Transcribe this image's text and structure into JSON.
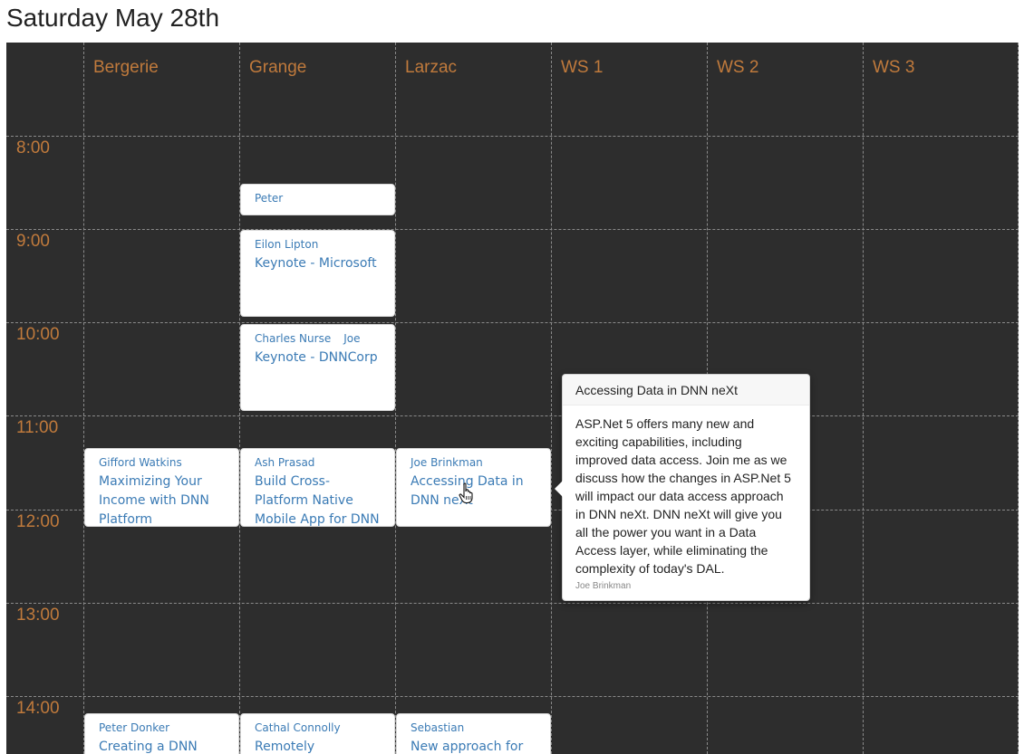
{
  "page": {
    "title": "Saturday May 28th"
  },
  "rooms": [
    "Bergerie",
    "Grange",
    "Larzac",
    "WS 1",
    "WS 2",
    "WS 3"
  ],
  "times": [
    "8:00",
    "9:00",
    "10:00",
    "11:00",
    "12:00",
    "13:00",
    "14:00"
  ],
  "sessions": {
    "s_peter": {
      "speakers": [
        "Peter"
      ],
      "title": ""
    },
    "s_keynote_ms": {
      "speakers": [
        "Eilon Lipton"
      ],
      "title": "Keynote - Microsoft"
    },
    "s_keynote_dnn": {
      "speakers": [
        "Charles Nurse",
        "Joe"
      ],
      "title": "Keynote - DNNCorp"
    },
    "s_income": {
      "speakers": [
        "Gifford Watkins"
      ],
      "title": "Maximizing Your Income with DNN Platform"
    },
    "s_mobile": {
      "speakers": [
        "Ash Prasad"
      ],
      "title": "Build Cross-Platform Native Mobile App for DNN"
    },
    "s_data": {
      "speakers": [
        "Joe Brinkman"
      ],
      "title": "Accessing Data in DNN neXt"
    },
    "s_creating": {
      "speakers": [
        "Peter Donker"
      ],
      "title": "Creating a DNN"
    },
    "s_remotely": {
      "speakers": [
        "Cathal Connolly"
      ],
      "title": "Remotely"
    },
    "s_newapproach": {
      "speakers": [
        "Sebastian"
      ],
      "title": "New approach for"
    }
  },
  "popover": {
    "title": "Accessing Data in DNN neXt",
    "body": "ASP.Net 5 offers many new and exciting capabilities, including improved data access. Join me as we discuss how the changes in ASP.Net 5 will impact our data access approach in DNN neXt. DNN neXt will give you all the power you want in a Data Access layer, while eliminating the complexity of today's DAL.",
    "speaker": "Joe Brinkman"
  },
  "colors": {
    "grid_bg": "#2d2d2d",
    "accent": "#c07a3c",
    "link": "#3b7bb5"
  },
  "icons": {
    "cursor": "hand-pointer-icon"
  }
}
